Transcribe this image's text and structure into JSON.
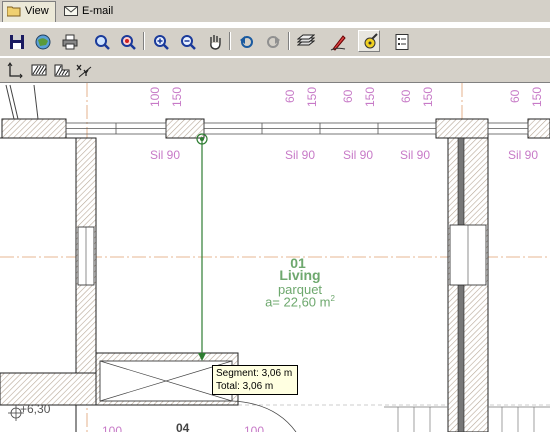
{
  "tabs": [
    {
      "label": "View",
      "icon": "folder-icon"
    },
    {
      "label": "E-mail",
      "icon": "envelope-icon"
    }
  ],
  "toolbar1": [
    {
      "name": "save-button",
      "icon": "floppy-disk-icon"
    },
    {
      "name": "internet-button",
      "icon": "globe-icon"
    },
    {
      "name": "print-button",
      "icon": "printer-icon"
    },
    {
      "name": "zoom-window-button",
      "icon": "zoom-window-icon"
    },
    {
      "name": "zoom-extents-button",
      "icon": "zoom-red-icon"
    },
    {
      "name": "zoom-in-button",
      "icon": "zoom-in-icon"
    },
    {
      "name": "zoom-out-button",
      "icon": "zoom-out-icon"
    },
    {
      "name": "pan-button",
      "icon": "hand-icon"
    },
    {
      "name": "back-button",
      "icon": "back-arrow-icon"
    },
    {
      "name": "forward-button",
      "icon": "forward-arrow-icon"
    },
    {
      "name": "layers-button",
      "icon": "layers-icon"
    },
    {
      "name": "pencil-button",
      "icon": "pencil-icon"
    },
    {
      "name": "measure-button",
      "icon": "tape-measure-icon"
    },
    {
      "name": "properties-button",
      "icon": "list-icon"
    }
  ],
  "toolbar2": [
    {
      "name": "dimension-button",
      "icon": "dimension-icon"
    },
    {
      "name": "hatch-button",
      "icon": "hatch-icon"
    },
    {
      "name": "area-button",
      "icon": "area-icon"
    },
    {
      "name": "coordinate-button",
      "icon": "xy-icon"
    }
  ],
  "plan": {
    "window_dims": [
      "100",
      "150",
      "60",
      "150",
      "60",
      "150",
      "60",
      "150",
      "60",
      "150"
    ],
    "sill_labels": [
      "Sil 90",
      "Sil 90",
      "Sil 90",
      "Sil 90",
      "Sil 90"
    ],
    "room_number": "01",
    "room_name": "Living",
    "room_floor": "parquet",
    "room_area": "a= 22,60 m",
    "room_area_sup": "2",
    "level": "+6,30",
    "room2_number": "04",
    "bottom_dims": [
      "100",
      "100"
    ]
  },
  "tooltip": {
    "segment": "Segment: 3,06 m",
    "total": "Total: 3,06 m"
  },
  "colors": {
    "wall_hatch": "#b8a898",
    "axis_line": "#e0a070",
    "dimension": "#c77ac7",
    "measure_line": "#2e7d32",
    "room_text": "#6ea86e"
  }
}
